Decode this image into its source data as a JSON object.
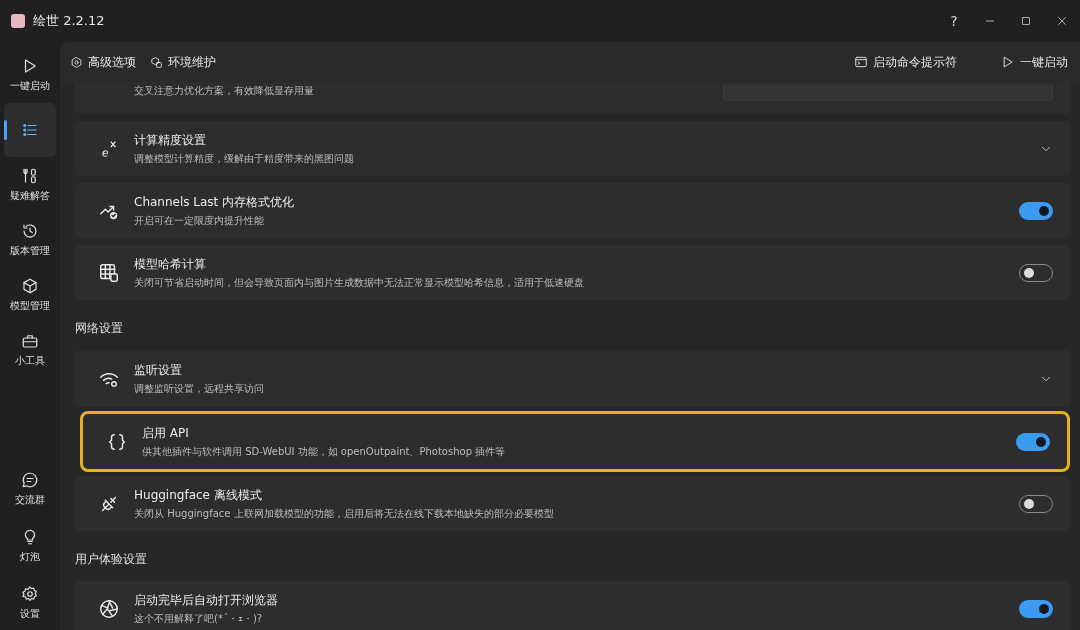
{
  "window": {
    "title": "绘世 2.2.12",
    "help": "?"
  },
  "sidebar": {
    "top": [
      {
        "label": "一键启动",
        "selected": false
      },
      {
        "selected": true
      },
      {
        "label": "疑难解答",
        "selected": false
      },
      {
        "label": "版本管理",
        "selected": false
      },
      {
        "label": "模型管理",
        "selected": false
      },
      {
        "label": "小工具",
        "selected": false
      }
    ],
    "bottom": [
      {
        "label": "交流群",
        "selected": false
      },
      {
        "label": "灯泡",
        "selected": false
      },
      {
        "label": "设置",
        "selected": false
      }
    ]
  },
  "toolbar": {
    "tabs": [
      {
        "label": "高级选项"
      },
      {
        "label": "环境维护"
      }
    ],
    "actions": [
      {
        "label": "启动命令提示符"
      },
      {
        "label": "一键启动"
      }
    ]
  },
  "settings": [
    {
      "kind": "partial",
      "description": "交叉注意力优化方案，有效降低显存用量"
    },
    {
      "kind": "expand",
      "title": "计算精度设置",
      "description": "调整模型计算精度，缓解由于精度带来的黑图问题",
      "highlighted": false
    },
    {
      "kind": "toggle",
      "title": "Channels Last 内存格式优化",
      "description": "开启可在一定限度内提升性能",
      "on": true,
      "highlighted": false
    },
    {
      "kind": "toggle",
      "title": "模型哈希计算",
      "description": "关闭可节省启动时间，但会导致页面内与图片生成数据中无法正常显示模型哈希信息，适用于低速硬盘",
      "on": false,
      "highlighted": false
    },
    {
      "kind": "section",
      "title": "网络设置"
    },
    {
      "kind": "expand",
      "title": "监听设置",
      "description": "调整监听设置，远程共享访问",
      "highlighted": false
    },
    {
      "kind": "toggle",
      "title": "启用 API",
      "description": "供其他插件与软件调用 SD-WebUI 功能，如 openOutpaint、Photoshop 插件等",
      "on": true,
      "highlighted": true
    },
    {
      "kind": "toggle",
      "title": "Huggingface 离线模式",
      "description": "关闭从 Huggingface 上联网加载模型的功能，启用后将无法在线下载本地缺失的部分必要模型",
      "on": false,
      "highlighted": false
    },
    {
      "kind": "section",
      "title": "用户体验设置"
    },
    {
      "kind": "toggle",
      "title": "启动完毕后自动打开浏览器",
      "description": "这个不用解释了吧(*´・ｪ・)?",
      "on": true,
      "highlighted": false
    }
  ]
}
